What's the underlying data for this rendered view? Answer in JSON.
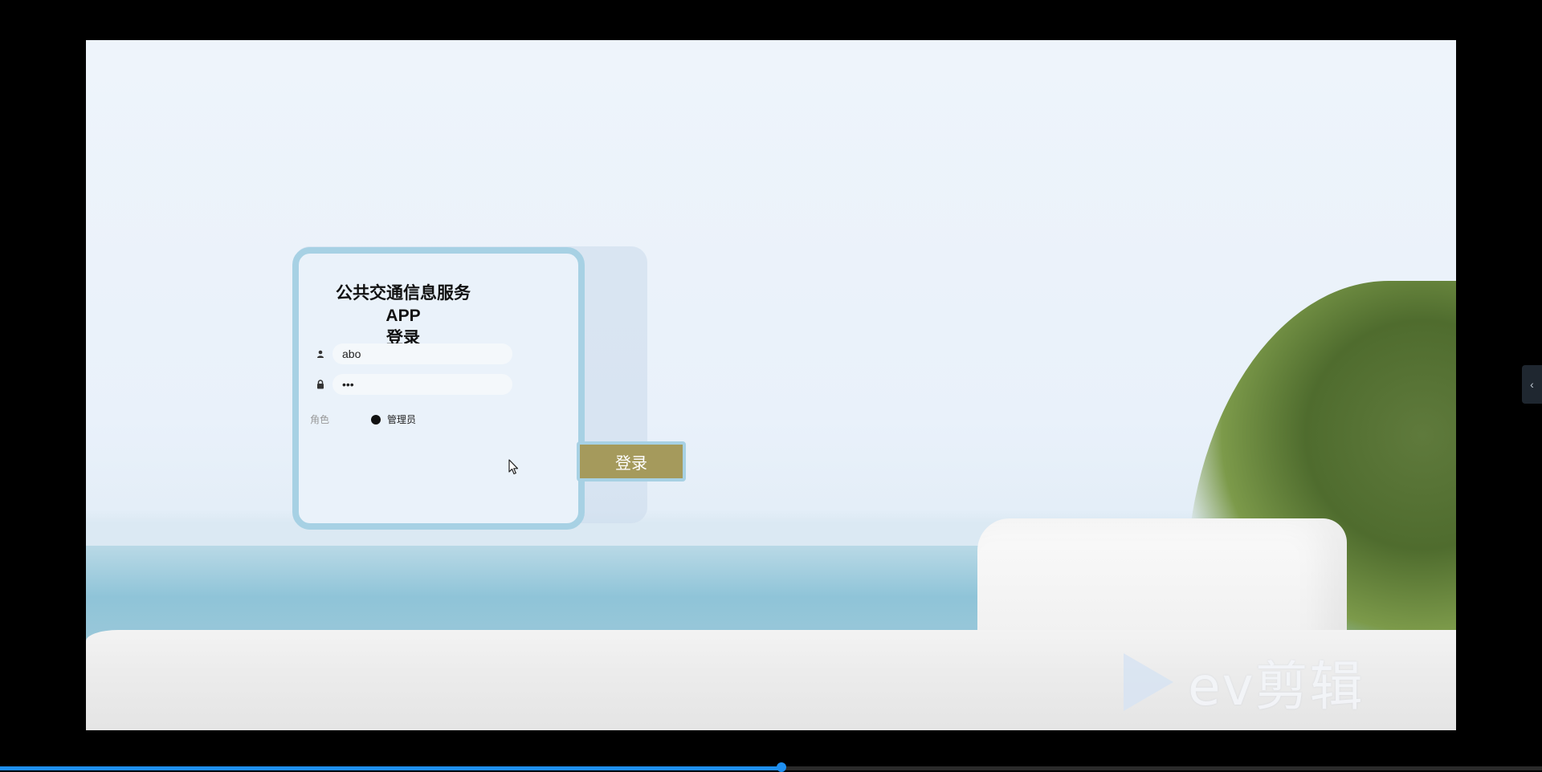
{
  "login": {
    "title_line1": "公共交通信息服务APP",
    "title_line2": "登录",
    "username_value": "abo",
    "password_value": "•••",
    "role_label": "角色",
    "role_option": "管理员",
    "submit_label": "登录"
  },
  "watermark": {
    "text": "ev剪辑"
  },
  "icons": {
    "user": "user-icon",
    "lock": "lock-icon",
    "collapse": "chevron-left-icon",
    "watermark": "play-icon",
    "cursor": "mouse-pointer-icon"
  },
  "player": {
    "progress": 0.507
  },
  "colors": {
    "card_border": "#a7d1e4",
    "button": "#a59a5c",
    "progress": "#1f8ff0"
  }
}
